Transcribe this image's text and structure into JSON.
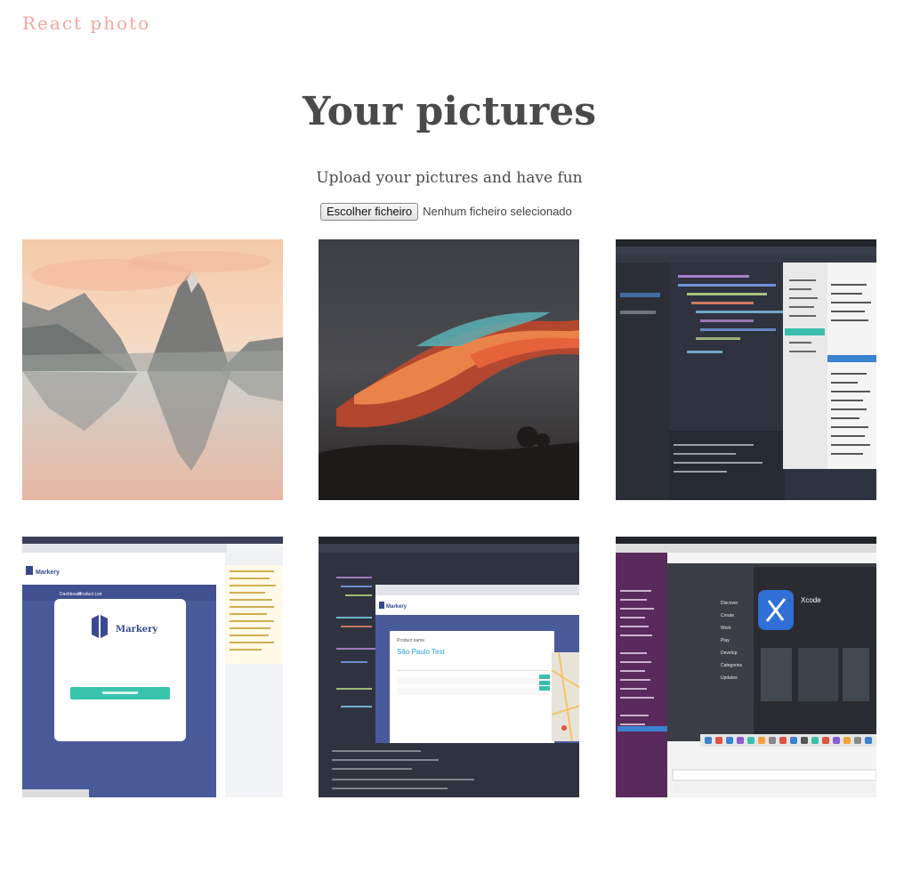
{
  "header": {
    "brand": "React photo"
  },
  "main": {
    "title": "Your pictures",
    "subtitle": "Upload your pictures and have fun",
    "upload": {
      "button_label": "Escolher ficheiro",
      "status": "Nenhum ficheiro selecionado"
    }
  },
  "gallery": {
    "photos": [
      {
        "subject": "mountain lake reflection at sunrise"
      },
      {
        "subject": "red sunset clouds over silhouette trees"
      },
      {
        "subject": "code editor screenshot with file explorer"
      },
      {
        "subject": "Markery login page in browser with devtools",
        "texts": [
          "Markery",
          "Markery",
          "Dashboard",
          "Product List"
        ]
      },
      {
        "subject": "code editor and Markery product page",
        "texts": [
          "Markery",
          "Product name",
          "São Paulo Test"
        ]
      },
      {
        "subject": "chat app with App Store Xcode page",
        "texts": [
          "Xcode",
          "Discover",
          "Create",
          "Work",
          "Play",
          "Develop",
          "Categories",
          "Updates"
        ]
      }
    ]
  }
}
